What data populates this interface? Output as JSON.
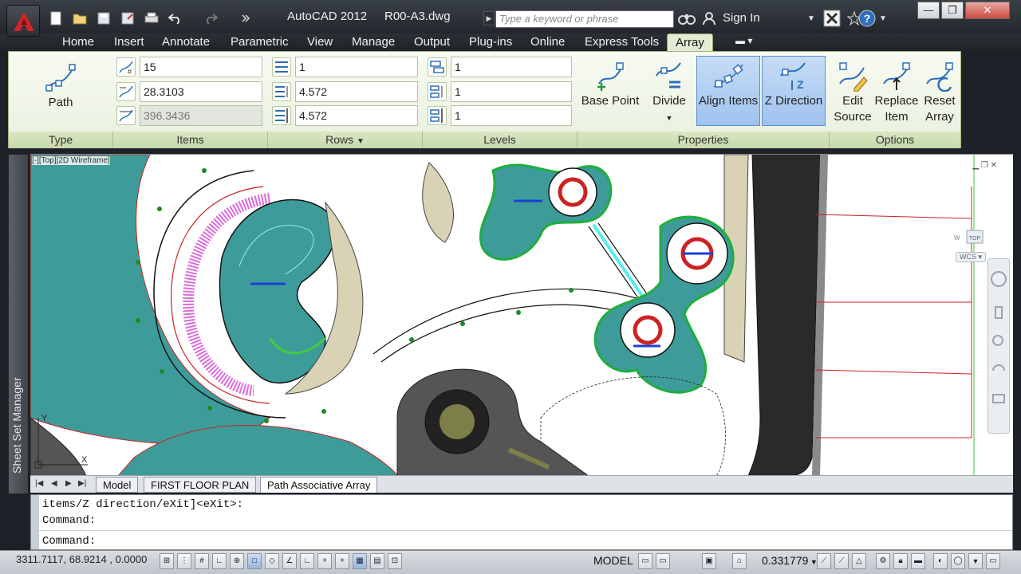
{
  "window": {
    "app_title": "AutoCAD 2012",
    "file_name": "R00-A3.dwg",
    "search_placeholder": "Type a keyword or phrase",
    "sign_in": "Sign In"
  },
  "ribbon_tabs": [
    "Home",
    "Insert",
    "Annotate",
    "Parametric",
    "View",
    "Manage",
    "Output",
    "Plug-ins",
    "Online",
    "Express Tools",
    "Array"
  ],
  "active_tab": "Array",
  "ribbon": {
    "type_panel": {
      "label": "Type",
      "button": "Path"
    },
    "items_panel": {
      "label": "Items",
      "count": "15",
      "between": "28.3103",
      "total": "396.3436"
    },
    "rows_panel": {
      "label": "Rows",
      "count": "1",
      "between": "4.572",
      "total": "4.572"
    },
    "levels_panel": {
      "label": "Levels",
      "count": "1",
      "between": "1",
      "total": "1"
    },
    "properties_panel": {
      "label": "Properties",
      "base_point": "Base Point",
      "divide": "Divide",
      "align_items": "Align Items",
      "z_direction": "Z Direction"
    },
    "options_panel": {
      "label": "Options",
      "edit_source": "Edit Source",
      "replace_item": "Replace Item",
      "reset_array": "Reset Array"
    }
  },
  "side_palette": {
    "title": "Sheet Set Manager"
  },
  "viewport": {
    "label": "[-][Top][2D Wireframe]",
    "viewcube_face": "TOP",
    "viewcube_west": "W",
    "wcs": "WCS"
  },
  "layout_tabs": [
    "Model",
    "FIRST FLOOR PLAN",
    "Path Associative Array"
  ],
  "active_layout": "Path Associative Array",
  "command": {
    "line1": "items/Z direction/eXit]<eXit>:",
    "line2": "Command:",
    "line3": "Command:"
  },
  "status": {
    "coordinates": "3311.7117, 68.9214 , 0.0000",
    "space": "MODEL",
    "scale": "0.331779"
  },
  "colors": {
    "water": "#3d9c9a",
    "ribbon_bg": "#eef4e4",
    "accent": "#5b8fcc"
  }
}
